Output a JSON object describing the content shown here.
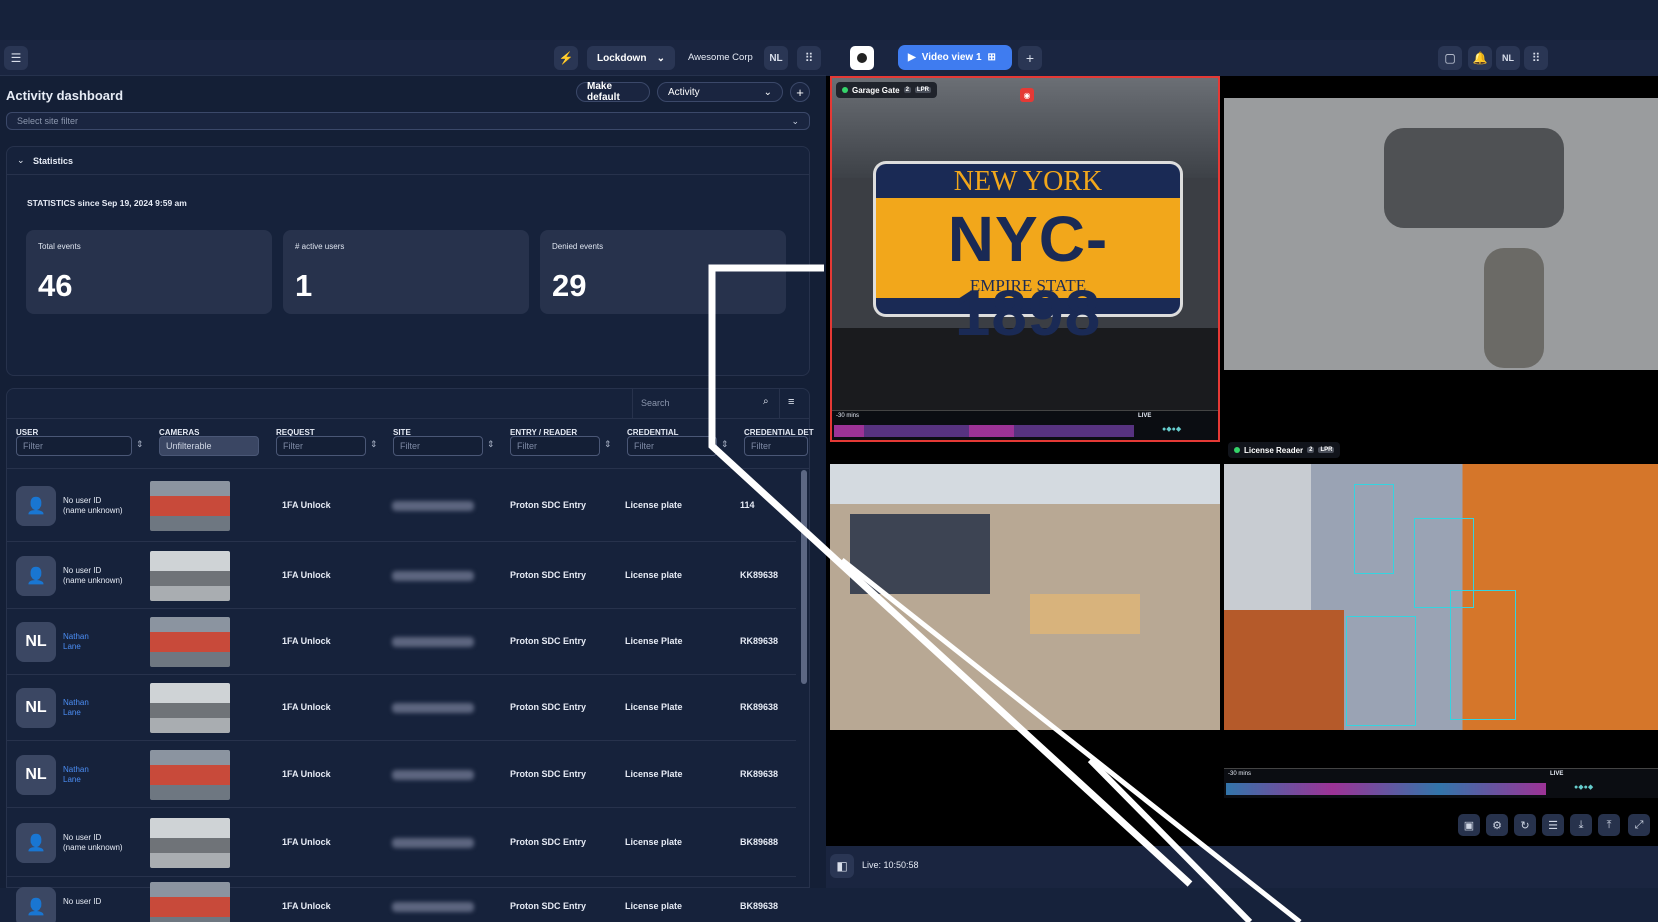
{
  "left_app": {
    "header": {
      "menu_icon": "hamburger-icon",
      "bolt_icon": "bolt-icon",
      "lockdown_label": "Lockdown",
      "org_name": "Awesome Corp",
      "user_initials": "NL",
      "apps_icon": "grid-icon"
    },
    "title": "Activity dashboard",
    "make_default_label": "Make default",
    "view_select_value": "Activity",
    "site_filter_placeholder": "Select site filter",
    "statistics": {
      "section_label": "Statistics",
      "since_label": "STATISTICS since Sep 19, 2024 9:59 am",
      "cards": [
        {
          "label": "Total events",
          "value": "46"
        },
        {
          "label": "# active users",
          "value": "1"
        },
        {
          "label": "Denied events",
          "value": "29"
        }
      ]
    },
    "search_placeholder": "Search",
    "columns": [
      {
        "header": "USER",
        "filter": "Filter"
      },
      {
        "header": "CAMERAS",
        "filter": "Unfilterable"
      },
      {
        "header": "REQUEST",
        "filter": "Filter"
      },
      {
        "header": "SITE",
        "filter": "Filter"
      },
      {
        "header": "ENTRY / READER",
        "filter": "Filter"
      },
      {
        "header": "CREDENTIAL",
        "filter": "Filter"
      },
      {
        "header": "CREDENTIAL DET",
        "filter": "Filter"
      }
    ],
    "rows": [
      {
        "avatar": "",
        "user_line1": "No user ID",
        "user_line2": "(name unknown)",
        "is_link": false,
        "request": "1FA Unlock",
        "entry": "Proton SDC Entry",
        "credential": "License plate",
        "detail": "114"
      },
      {
        "avatar": "",
        "user_line1": "No user ID",
        "user_line2": "(name unknown)",
        "is_link": false,
        "request": "1FA Unlock",
        "entry": "Proton SDC Entry",
        "credential": "License plate",
        "detail": "KK89638"
      },
      {
        "avatar": "NL",
        "user_line1": "Nathan",
        "user_line2": "Lane",
        "is_link": true,
        "request": "1FA Unlock",
        "entry": "Proton SDC Entry",
        "credential": "License Plate",
        "detail": "RK89638"
      },
      {
        "avatar": "NL",
        "user_line1": "Nathan",
        "user_line2": "Lane",
        "is_link": true,
        "request": "1FA Unlock",
        "entry": "Proton SDC Entry",
        "credential": "License Plate",
        "detail": "RK89638"
      },
      {
        "avatar": "NL",
        "user_line1": "Nathan",
        "user_line2": "Lane",
        "is_link": true,
        "request": "1FA Unlock",
        "entry": "Proton SDC Entry",
        "credential": "License Plate",
        "detail": "RK89638"
      },
      {
        "avatar": "",
        "user_line1": "No user ID",
        "user_line2": "(name unknown)",
        "is_link": false,
        "request": "1FA Unlock",
        "entry": "Proton SDC Entry",
        "credential": "License plate",
        "detail": "BK89688"
      },
      {
        "avatar": "",
        "user_line1": "No user ID",
        "user_line2": "",
        "is_link": false,
        "request": "1FA Unlock",
        "entry": "Proton SDC Entry",
        "credential": "License plate",
        "detail": "BK89638"
      }
    ]
  },
  "right_app": {
    "tab_label": "Video view 1",
    "user_initials": "NL",
    "cameras": [
      {
        "name": "Garage Gate",
        "badge": "2",
        "tag": "LPR",
        "selected": true
      },
      {
        "name": "",
        "badge": "",
        "tag": ""
      },
      {
        "name": "",
        "badge": "",
        "tag": ""
      },
      {
        "name": "License Reader",
        "badge": "2",
        "tag": "LPR"
      }
    ],
    "plate": {
      "state": "NEW YORK",
      "number": "NYC-1898",
      "slogan": "EMPIRE STATE"
    },
    "timeline_start": "-30 mins",
    "timeline_live": "LIVE",
    "live_time": "Live: 10:50:58",
    "colors": {
      "accent": "#3f7cf0",
      "selected_border": "#e53935",
      "plate_yellow": "#f2a71b",
      "plate_blue": "#1a2a55"
    }
  }
}
